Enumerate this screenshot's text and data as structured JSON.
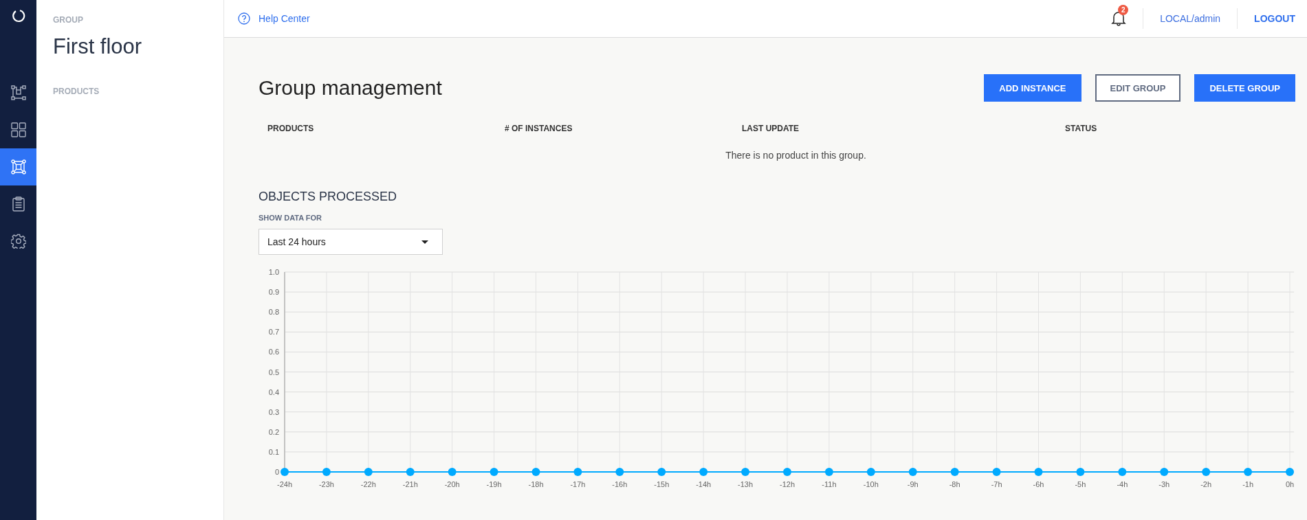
{
  "nav": {
    "items": [
      {
        "selected": false
      },
      {
        "selected": false
      },
      {
        "selected": true
      },
      {
        "selected": false
      },
      {
        "selected": false
      }
    ]
  },
  "sidebar": {
    "group_label": "GROUP",
    "group_name": "First floor",
    "products_label": "PRODUCTS"
  },
  "topbar": {
    "help": "Help Center",
    "notifications": "2",
    "user": "LOCAL/admin",
    "logout": "LOGOUT"
  },
  "page": {
    "title": "Group management",
    "buttons": [
      {
        "label": "ADD INSTANCE",
        "kind": "primary"
      },
      {
        "label": "EDIT GROUP",
        "kind": "outline"
      },
      {
        "label": "DELETE GROUP",
        "kind": "primary"
      }
    ]
  },
  "table": {
    "columns": [
      "PRODUCTS",
      "# OF INSTANCES",
      "LAST UPDATE",
      "STATUS"
    ],
    "empty": "There is no product in this group."
  },
  "objects": {
    "title": "OBJECTS PROCESSED",
    "filter_label": "SHOW DATA FOR",
    "filter_value": "Last 24 hours",
    "chart_data": {
      "type": "line",
      "categories": [
        "-24h",
        "-23h",
        "-22h",
        "-21h",
        "-20h",
        "-19h",
        "-18h",
        "-17h",
        "-16h",
        "-15h",
        "-14h",
        "-13h",
        "-12h",
        "-11h",
        "-10h",
        "-9h",
        "-8h",
        "-7h",
        "-6h",
        "-5h",
        "-4h",
        "-3h",
        "-2h",
        "-1h",
        "0h"
      ],
      "grid": true,
      "series": [
        {
          "color": "#00aaff",
          "marker": "circle",
          "values": [
            0,
            0,
            0,
            0,
            0,
            0,
            0,
            0,
            0,
            0,
            0,
            0,
            0,
            0,
            0,
            0,
            0,
            0,
            0,
            0,
            0,
            0,
            0,
            0,
            0
          ]
        }
      ],
      "ylim": [
        0,
        1
      ],
      "yticks": [
        {
          "value": 0,
          "label": "0"
        },
        0.1,
        0.2,
        0.3,
        0.4,
        0.5,
        0.6,
        0.7,
        0.8,
        0.9,
        {
          "value": 1,
          "label": "1.0"
        }
      ]
    }
  }
}
